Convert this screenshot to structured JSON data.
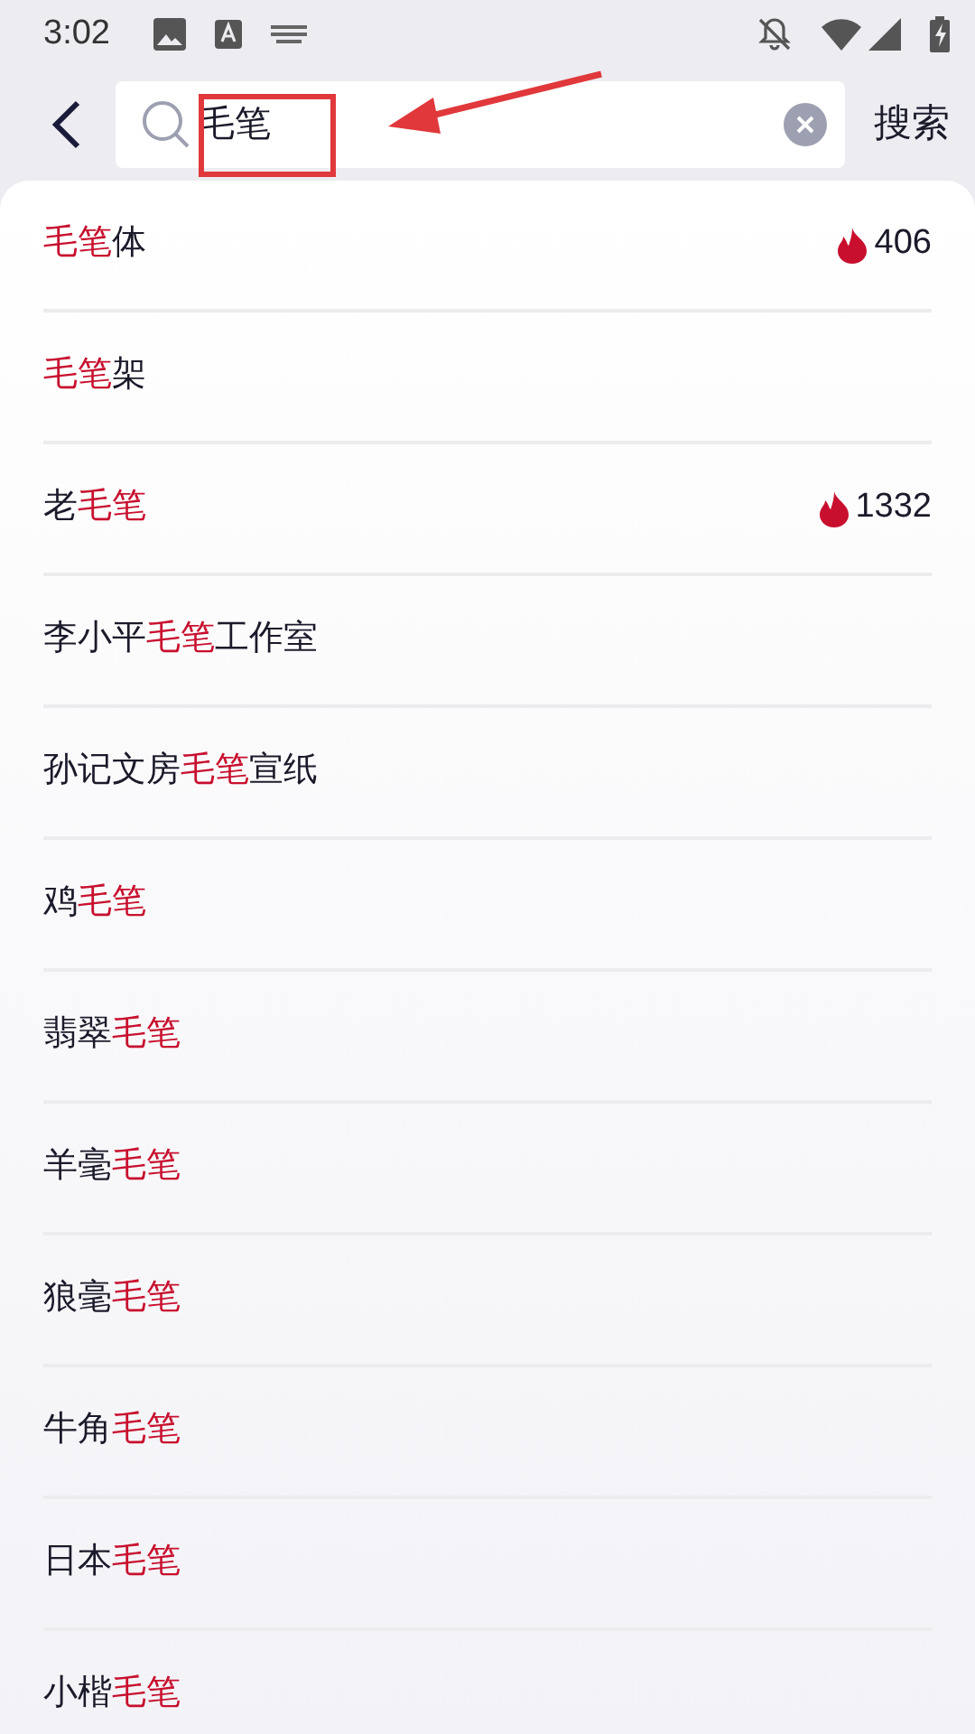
{
  "status_bar": {
    "time": "3:02"
  },
  "search": {
    "value": "毛笔",
    "action": "搜索"
  },
  "suggestions": [
    {
      "parts": [
        {
          "text": "毛笔",
          "highlight": true
        },
        {
          "text": "体",
          "highlight": false
        }
      ],
      "hot": "406"
    },
    {
      "parts": [
        {
          "text": "毛笔",
          "highlight": true
        },
        {
          "text": "架",
          "highlight": false
        }
      ]
    },
    {
      "parts": [
        {
          "text": "老",
          "highlight": false
        },
        {
          "text": "毛笔",
          "highlight": true
        }
      ],
      "hot": "1332"
    },
    {
      "parts": [
        {
          "text": "李小平",
          "highlight": false
        },
        {
          "text": "毛笔",
          "highlight": true
        },
        {
          "text": "工作室",
          "highlight": false
        }
      ]
    },
    {
      "parts": [
        {
          "text": "孙记文房",
          "highlight": false
        },
        {
          "text": "毛笔",
          "highlight": true
        },
        {
          "text": "宣纸",
          "highlight": false
        }
      ]
    },
    {
      "parts": [
        {
          "text": "鸡",
          "highlight": false
        },
        {
          "text": "毛笔",
          "highlight": true
        }
      ]
    },
    {
      "parts": [
        {
          "text": "翡翠",
          "highlight": false
        },
        {
          "text": "毛笔",
          "highlight": true
        }
      ]
    },
    {
      "parts": [
        {
          "text": "羊毫",
          "highlight": false
        },
        {
          "text": "毛笔",
          "highlight": true
        }
      ]
    },
    {
      "parts": [
        {
          "text": "狼毫",
          "highlight": false
        },
        {
          "text": "毛笔",
          "highlight": true
        }
      ]
    },
    {
      "parts": [
        {
          "text": "牛角",
          "highlight": false
        },
        {
          "text": "毛笔",
          "highlight": true
        }
      ]
    },
    {
      "parts": [
        {
          "text": "日本",
          "highlight": false
        },
        {
          "text": "毛笔",
          "highlight": true
        }
      ]
    },
    {
      "parts": [
        {
          "text": "小楷",
          "highlight": false
        },
        {
          "text": "毛笔",
          "highlight": true
        }
      ]
    }
  ]
}
